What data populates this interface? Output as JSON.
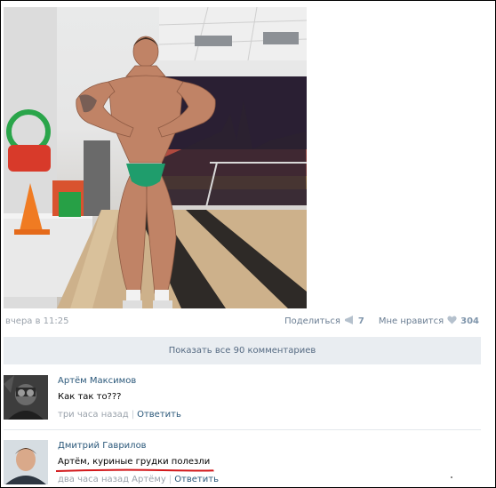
{
  "post": {
    "timestamp": "вчера в 11:25",
    "share_label": "Поделиться",
    "share_count": "7",
    "like_label": "Мне нравится",
    "like_count": "304"
  },
  "comments_bar": {
    "label": "Показать все 90 комментариев"
  },
  "comments": [
    {
      "author": "Артём Максимов",
      "text": "Как так то???",
      "time": "три часа назад",
      "reply_to": "",
      "reply_label": "Ответить"
    },
    {
      "author": "Дмитрий Гаврилов",
      "text": "Артём, куриные грудки полезли",
      "time": "два часа назад",
      "reply_to": "Артёму",
      "reply_label": "Ответить"
    }
  ],
  "icons": {
    "share": "megaphone-icon",
    "like": "heart-icon"
  },
  "colors": {
    "link": "#2b587a",
    "muted": "#9aa2ab",
    "bar_bg": "#e9edf1",
    "underline": "#d2181b"
  }
}
